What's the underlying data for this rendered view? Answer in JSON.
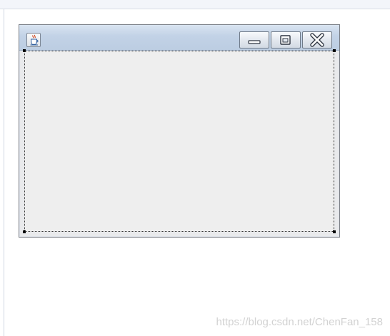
{
  "window": {
    "title": "",
    "app_icon": "java-coffee-cup-icon",
    "controls": {
      "minimize_icon": "minimize-icon",
      "maximize_icon": "maximize-icon",
      "close_icon": "close-icon"
    }
  },
  "watermark": {
    "text": "https://blog.csdn.net/ChenFan_158"
  },
  "colors": {
    "titlebar": "#c2d2e6",
    "content_background": "#eeeeee",
    "window_border": "#7b7f86"
  }
}
